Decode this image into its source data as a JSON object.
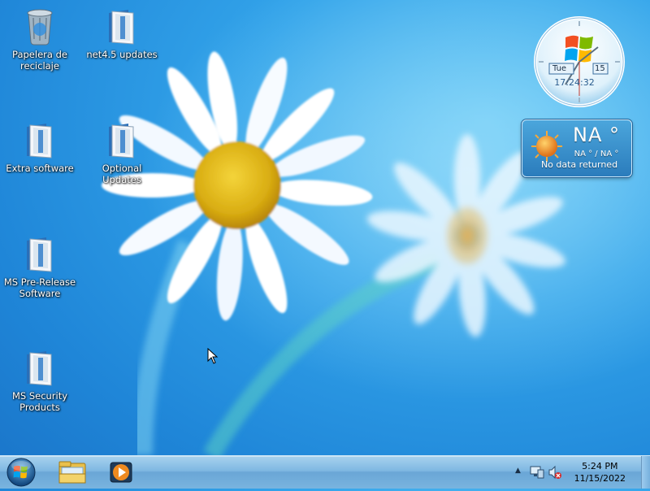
{
  "desktop": {
    "icons": [
      {
        "label": "Papelera de reciclaje",
        "icon": "recycle-bin-icon"
      },
      {
        "label": "net4.5 updates",
        "icon": "folder-icon"
      },
      {
        "label": "Extra software",
        "icon": "folder-icon"
      },
      {
        "label": "Optional Updates",
        "icon": "folder-icon"
      },
      {
        "label": "MS Pre-Release Software",
        "icon": "folder-icon"
      },
      {
        "label": "MS Security Products",
        "icon": "folder-icon"
      }
    ]
  },
  "clock_gadget": {
    "day": "Tue",
    "date": "15",
    "time": "17:24:32"
  },
  "weather_gadget": {
    "temperature": "NA °",
    "range": "NA ° / NA °",
    "message": "No data returned",
    "icon": "sun-icon"
  },
  "taskbar": {
    "start_icon": "windows-logo-icon",
    "pinned": [
      {
        "name": "File Explorer",
        "icon": "file-explorer-icon"
      },
      {
        "name": "Windows Media Player",
        "icon": "media-player-icon"
      }
    ],
    "tray": {
      "time": "5:24 PM",
      "date": "11/15/2022",
      "icons": [
        "show-hidden-icons-icon",
        "network-icon",
        "volume-muted-icon"
      ]
    }
  },
  "colors": {
    "desktop_blue": "#33a4ea",
    "taskbar": "#7fb8e2",
    "weather_panel": "#3a92cf"
  }
}
